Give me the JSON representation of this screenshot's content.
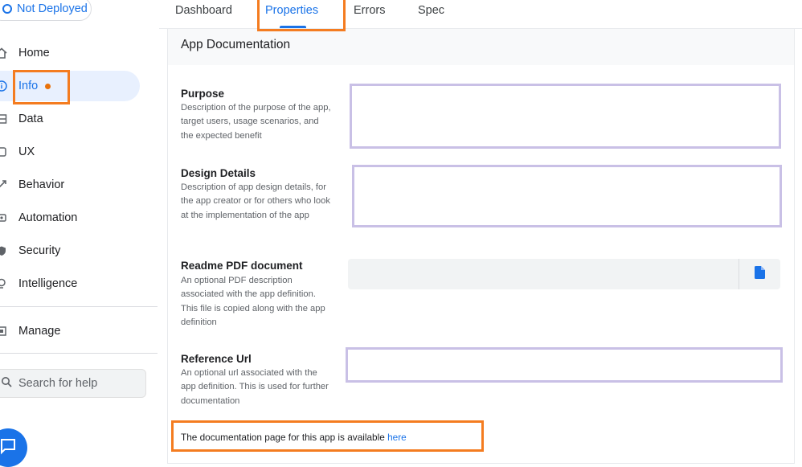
{
  "status": {
    "label": "Not Deployed"
  },
  "sidebar": {
    "items": [
      {
        "label": "Home",
        "icon": "home-icon"
      },
      {
        "label": "Info",
        "icon": "info-icon",
        "active": true
      },
      {
        "label": "Data",
        "icon": "table-icon"
      },
      {
        "label": "UX",
        "icon": "ux-icon"
      },
      {
        "label": "Behavior",
        "icon": "behavior-icon"
      },
      {
        "label": "Automation",
        "icon": "automation-icon"
      },
      {
        "label": "Security",
        "icon": "shield-icon"
      },
      {
        "label": "Intelligence",
        "icon": "lightbulb-icon"
      }
    ],
    "manage": {
      "label": "Manage",
      "icon": "manage-icon"
    },
    "help": {
      "placeholder": "Search for help",
      "icon": "search-icon"
    },
    "chat": {
      "icon": "chat-icon"
    }
  },
  "tabs": [
    {
      "label": "Dashboard"
    },
    {
      "label": "Properties",
      "active": true
    },
    {
      "label": "Errors"
    },
    {
      "label": "Spec"
    }
  ],
  "panel": {
    "title": "App Documentation",
    "fields": {
      "purpose": {
        "title": "Purpose",
        "desc": "Description of the purpose of the app, target users, usage scenarios, and the expected benefit",
        "value": ""
      },
      "design": {
        "title": "Design Details",
        "desc": "Description of app design details, for the app creator or for others who look at the implementation of the app",
        "value": ""
      },
      "readme": {
        "title": "Readme PDF document",
        "desc": "An optional PDF description associated with the app definition. This file is copied along with the app definition",
        "icon": "file-icon"
      },
      "url": {
        "title": "Reference Url",
        "desc": "An optional url associated with the app definition. This is used for further documentation",
        "value": ""
      }
    },
    "doc_note": {
      "text": "The documentation page for this app is available ",
      "link": "here"
    }
  },
  "colors": {
    "accent": "#1a73e8",
    "highlight": "#f47c20",
    "status_dot": "#e8710a",
    "field_border": "#c9c0e6"
  }
}
